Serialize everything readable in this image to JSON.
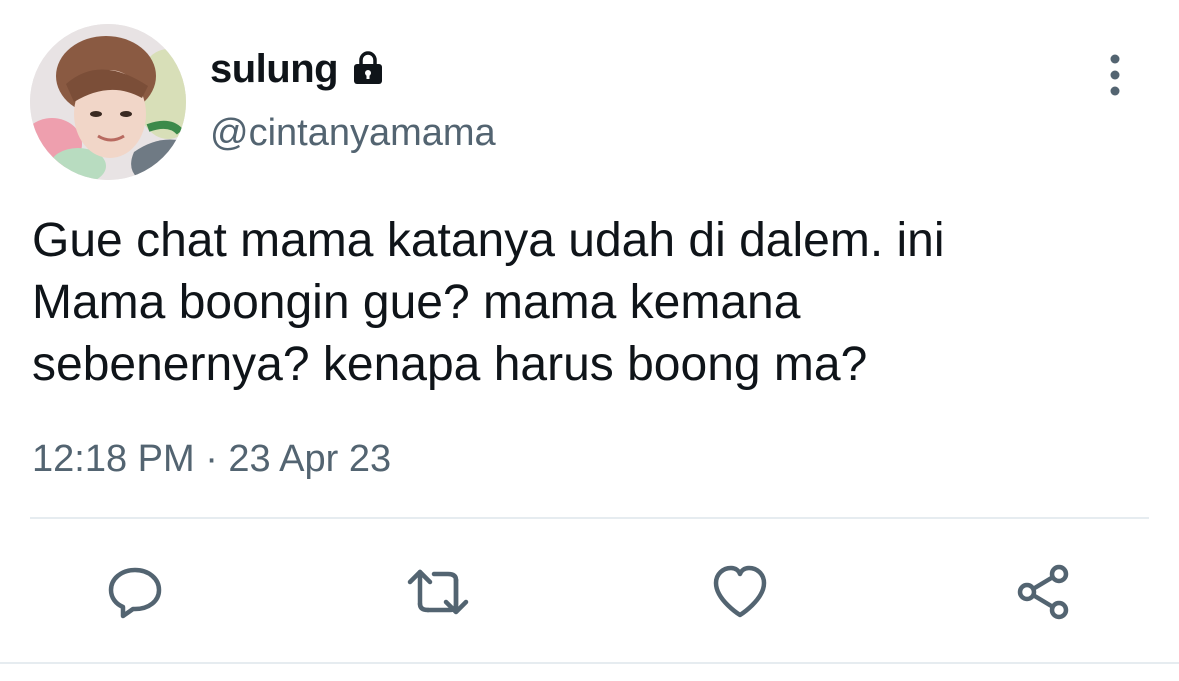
{
  "user": {
    "display_name": "sulung",
    "handle": "@cintanyamama",
    "protected_icon": "lock-icon",
    "avatar_icon": "avatar-photo"
  },
  "tweet": {
    "text": "Gue chat mama katanya udah di dalem. ini\nMama boongin gue? mama kemana\nsebenernya? kenapa harus boong ma?",
    "timestamp": "12:18 PM · 23 Apr 23"
  },
  "actions": [
    {
      "icon": "reply-icon"
    },
    {
      "icon": "retweet-icon"
    },
    {
      "icon": "like-icon"
    },
    {
      "icon": "share-icon"
    }
  ],
  "menu_icon": "more-options-icon",
  "colors": {
    "text": "#0f1419",
    "secondary": "#536471",
    "divider": "#e6ecf0",
    "background": "#ffffff"
  }
}
